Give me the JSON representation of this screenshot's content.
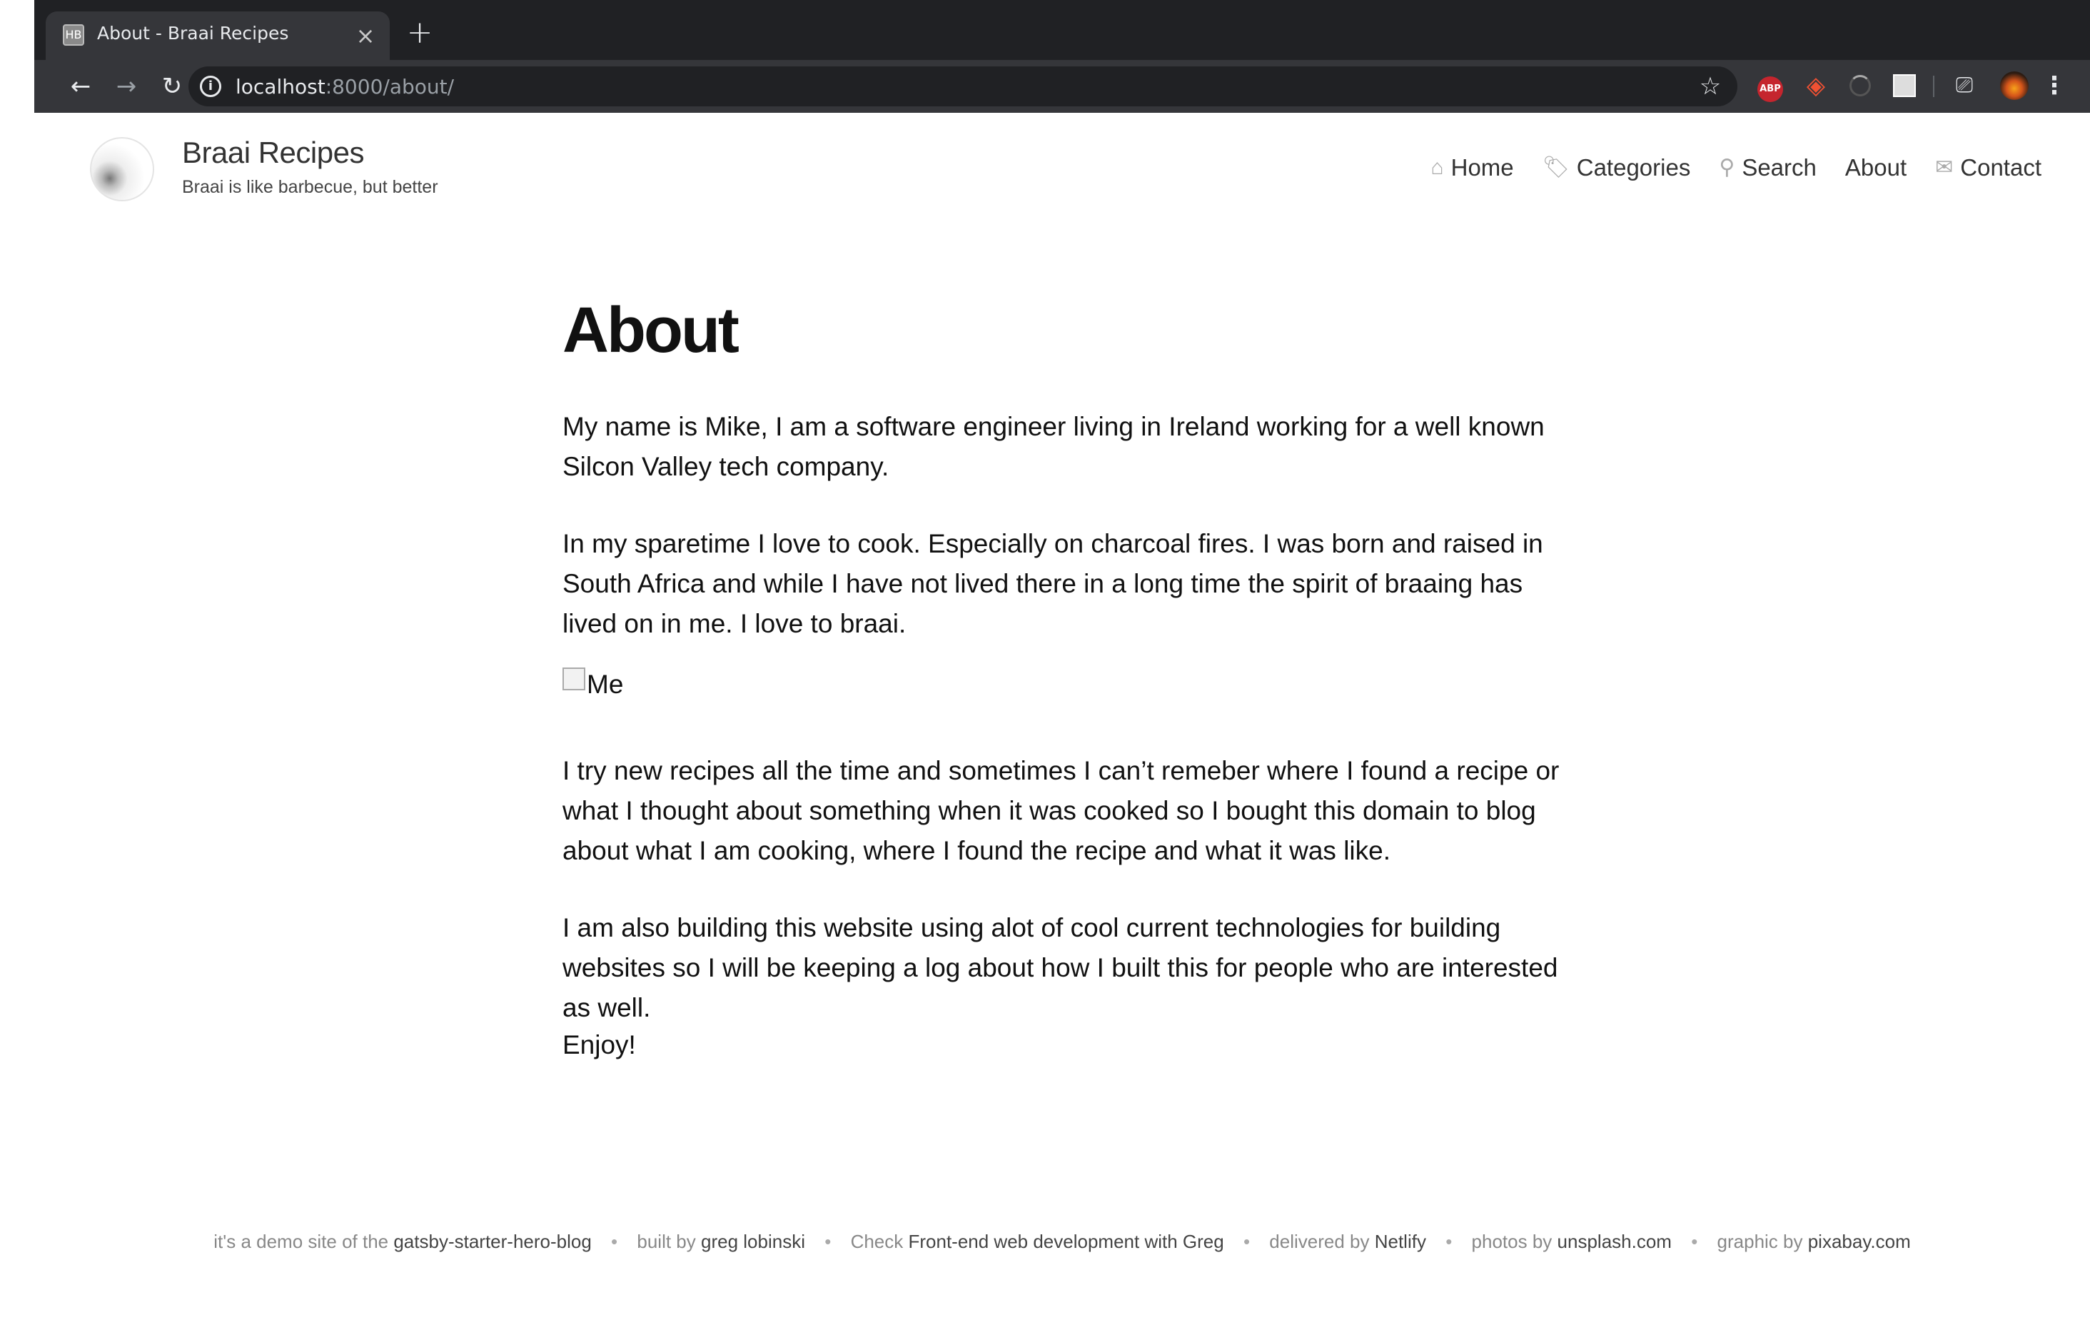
{
  "browser": {
    "tab_favicon": "HB",
    "tab_title": "About - Braai Recipes",
    "tab_close": "×",
    "new_tab": "+",
    "url_host": "localhost",
    "url_path": ":8000/about/",
    "ext_abp": "ABP"
  },
  "site": {
    "title": "Braai Recipes",
    "subtitle": "Braai is like barbecue, but better",
    "nav": [
      {
        "label": "Home",
        "icon": "home-icon"
      },
      {
        "label": "Categories",
        "icon": "tag-icon"
      },
      {
        "label": "Search",
        "icon": "search-icon"
      },
      {
        "label": "About",
        "icon": ""
      },
      {
        "label": "Contact",
        "icon": "envelope-icon"
      }
    ]
  },
  "page": {
    "title": "About",
    "p1": "My name is Mike, I am a software engineer living in Ireland working for a well known Silcon Valley tech company.",
    "p2": "In my sparetime I love to cook. Especially on charcoal fires. I was born and raised in South Africa and while I have not lived there in a long time the spirit of braaing has lived on in me. I love to braai.",
    "img_alt": "Me",
    "p3": "I try new recipes all the time and sometimes I can’t remeber where I found a recipe or what I thought about something when it was cooked so I bought this domain to blog about what I am cooking, where I found the recipe and what it was like.",
    "p4": "I am also building this website using alot of cool current technologies for building websites so I will be keeping a log about how I built this for people who are interested as well.",
    "p5": "Enjoy!"
  },
  "footer": {
    "t1": "it's a demo site of the ",
    "l1": "gatsby-starter-hero-blog",
    "t2": "built by ",
    "l2": "greg lobinski",
    "t3": "Check ",
    "l3": "Front-end web development with Greg",
    "t4": "delivered by ",
    "l4": "Netlify",
    "t5": "photos by ",
    "l5": "unsplash.com",
    "t6": "graphic by ",
    "l6": "pixabay.com",
    "sep": "•"
  }
}
